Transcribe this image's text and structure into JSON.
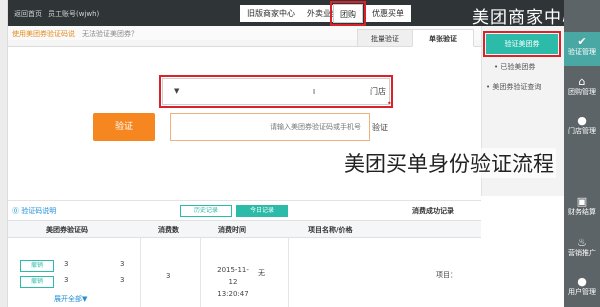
{
  "window": {
    "brand_title": "美团商家中心",
    "brand_mark": "M"
  },
  "topbar": {
    "left_links": [
      "返回首页",
      "员工账号(wjwh)"
    ],
    "buttons": [
      {
        "label": "团购"
      },
      {
        "label": "优惠买单"
      },
      {
        "label": "外卖业务"
      },
      {
        "label": "旧版商家中心"
      }
    ]
  },
  "sidebar": {
    "items": [
      {
        "label": "验证管理",
        "icon": "check-icon",
        "active": true
      },
      {
        "label": "团购管理",
        "icon": "store-icon"
      },
      {
        "label": "门店管理",
        "icon": "user-icon"
      },
      {
        "label": "财务结算",
        "icon": "gift-icon"
      },
      {
        "label": "营销推广",
        "icon": "fire-icon"
      },
      {
        "label": "用户管理",
        "icon": "user-icon"
      }
    ]
  },
  "submenu": {
    "active": "验证美团券",
    "links": [
      "已验美团券",
      "美团券验证查询"
    ]
  },
  "breadcrumb": {
    "a": "无法验证美团券？",
    "b": "使用美团券验证码说"
  },
  "tabs": [
    {
      "label": "单张验证"
    },
    {
      "label": "批量验证"
    }
  ],
  "form": {
    "store_label": "门店",
    "store_value": "I",
    "code_label": "验证",
    "code_placeholder": "请输入美团券验证码或手机号",
    "verify_button": "验证"
  },
  "overlay_caption": "美团买单身份验证流程",
  "records": {
    "title": "消费成功记录",
    "tab_today": "今日记录",
    "tab_history": "历史记录",
    "help_link": "⓪ 验证码说明",
    "count": ""
  },
  "table": {
    "headers": [
      "项目名称/价格",
      "消费时间",
      "消费数",
      "美团券验证码"
    ],
    "rows": [
      {
        "name": "项目：",
        "time": "2015-11-12 13:20:47",
        "count": "3",
        "codes": [
          "3",
          "3"
        ],
        "buttons": [
          "撤销",
          "撤销"
        ],
        "store": "无"
      }
    ],
    "expand": "展开全部▼"
  }
}
